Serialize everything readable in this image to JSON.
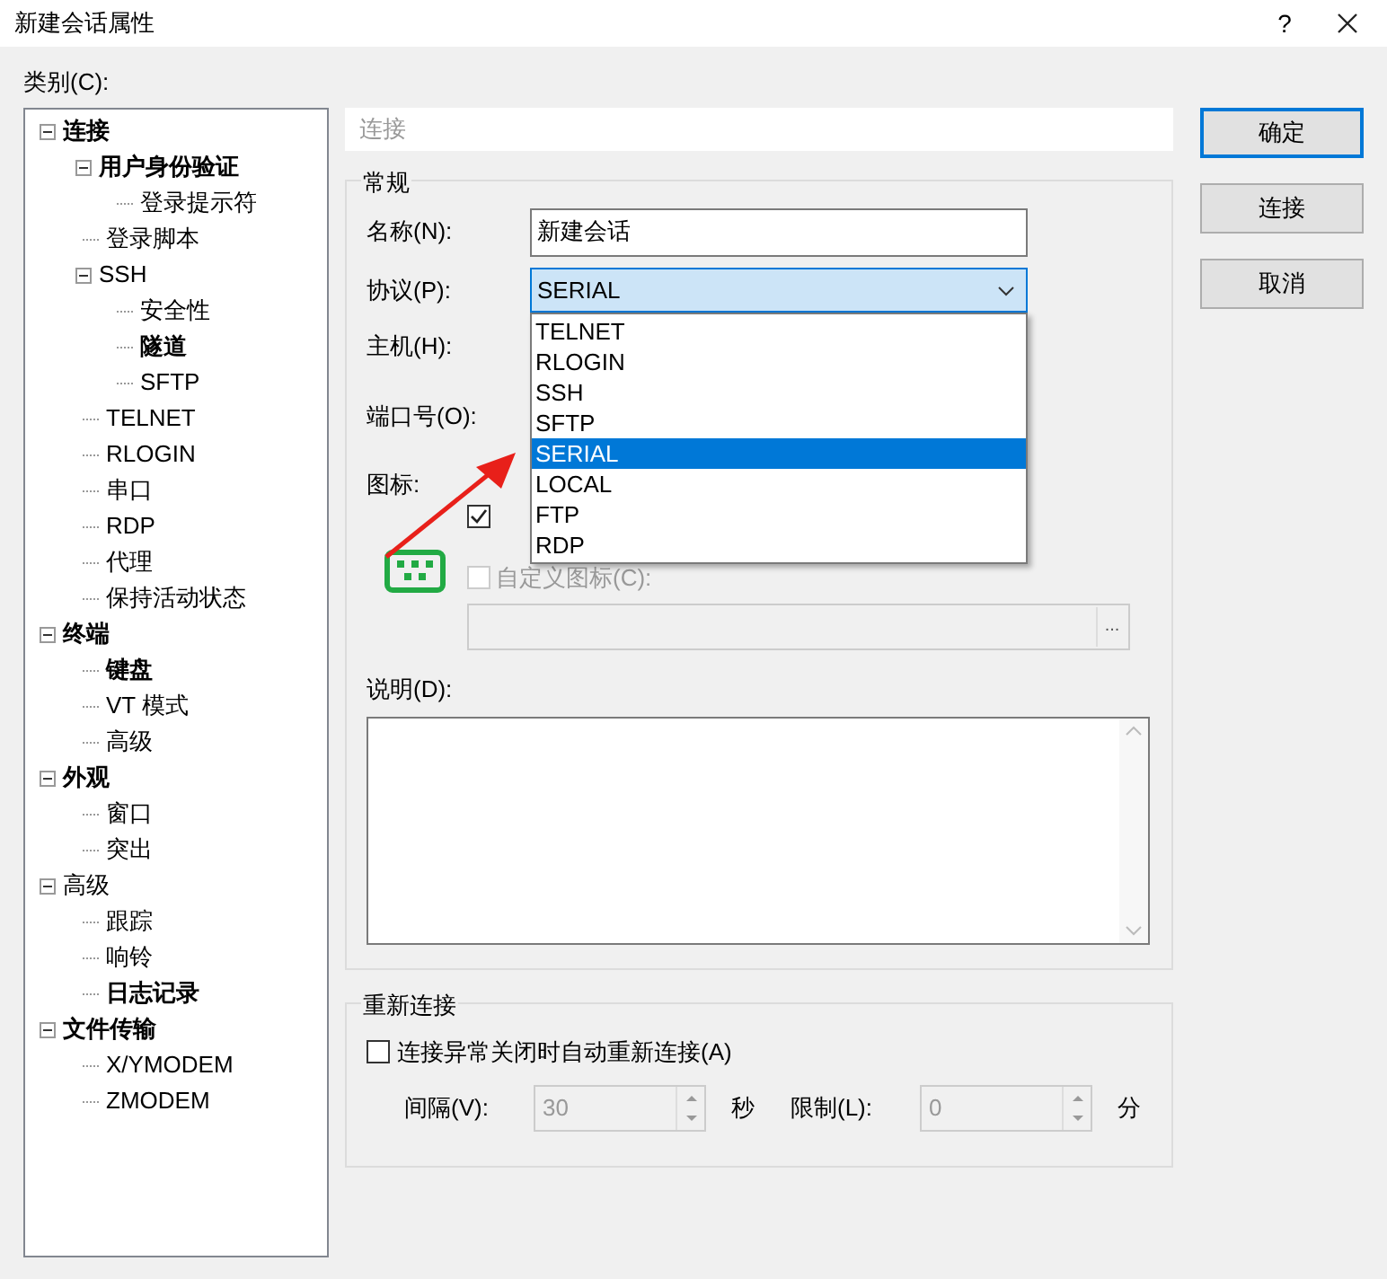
{
  "window": {
    "title": "新建会话属性",
    "help": "?"
  },
  "category_label": "类别(C):",
  "tree": [
    {
      "label": "连接",
      "bold": true,
      "expanded": true,
      "children": [
        {
          "label": "用户身份验证",
          "bold": true,
          "expanded": true,
          "children": [
            {
              "label": "登录提示符",
              "bold": false
            }
          ]
        },
        {
          "label": "登录脚本",
          "bold": false
        },
        {
          "label": "SSH",
          "bold": false,
          "expanded": true,
          "children": [
            {
              "label": "安全性",
              "bold": false
            },
            {
              "label": "隧道",
              "bold": true
            },
            {
              "label": "SFTP",
              "bold": false
            }
          ]
        },
        {
          "label": "TELNET",
          "bold": false
        },
        {
          "label": "RLOGIN",
          "bold": false
        },
        {
          "label": "串口",
          "bold": false
        },
        {
          "label": "RDP",
          "bold": false
        },
        {
          "label": "代理",
          "bold": false
        },
        {
          "label": "保持活动状态",
          "bold": false
        }
      ]
    },
    {
      "label": "终端",
      "bold": true,
      "expanded": true,
      "children": [
        {
          "label": "键盘",
          "bold": true
        },
        {
          "label": "VT 模式",
          "bold": false
        },
        {
          "label": "高级",
          "bold": false
        }
      ]
    },
    {
      "label": "外观",
      "bold": true,
      "expanded": true,
      "children": [
        {
          "label": "窗口",
          "bold": false
        },
        {
          "label": "突出",
          "bold": false
        }
      ]
    },
    {
      "label": "高级",
      "bold": false,
      "expanded": true,
      "children": [
        {
          "label": "跟踪",
          "bold": false
        },
        {
          "label": "响铃",
          "bold": false
        },
        {
          "label": "日志记录",
          "bold": true
        }
      ]
    },
    {
      "label": "文件传输",
      "bold": true,
      "expanded": true,
      "children": [
        {
          "label": "X/YMODEM",
          "bold": false
        },
        {
          "label": "ZMODEM",
          "bold": false
        }
      ]
    }
  ],
  "page_title": "连接",
  "general": {
    "title": "常规",
    "name": {
      "label": "名称(N):",
      "value": "新建会话"
    },
    "protocol": {
      "label": "协议(P):",
      "value": "SERIAL",
      "expanded": true,
      "options": [
        {
          "label": "TELNET",
          "selected": false
        },
        {
          "label": "RLOGIN",
          "selected": false
        },
        {
          "label": "SSH",
          "selected": false
        },
        {
          "label": "SFTP",
          "selected": false
        },
        {
          "label": "SERIAL",
          "selected": true
        },
        {
          "label": "LOCAL",
          "selected": false
        },
        {
          "label": "FTP",
          "selected": false
        },
        {
          "label": "RDP",
          "selected": false
        }
      ]
    },
    "host_label": "主机(H):",
    "port_label": "端口号(O):",
    "icon_label": "图标:",
    "default_icon_checked": true,
    "custom_icon": {
      "label": "自定义图标(C):",
      "checked": false,
      "disabled": true,
      "browse": "..."
    },
    "description_label": "说明(D):"
  },
  "reconnect": {
    "title": "重新连接",
    "auto": {
      "label": "连接异常关闭时自动重新连接(A)",
      "checked": false
    },
    "interval": {
      "label": "间隔(V):",
      "value": "30",
      "unit": "秒"
    },
    "limit": {
      "label": "限制(L):",
      "value": "0",
      "unit": "分"
    }
  },
  "buttons": [
    {
      "label": "确定",
      "default": true
    },
    {
      "label": "连接",
      "default": false
    },
    {
      "label": "取消",
      "default": false
    }
  ]
}
